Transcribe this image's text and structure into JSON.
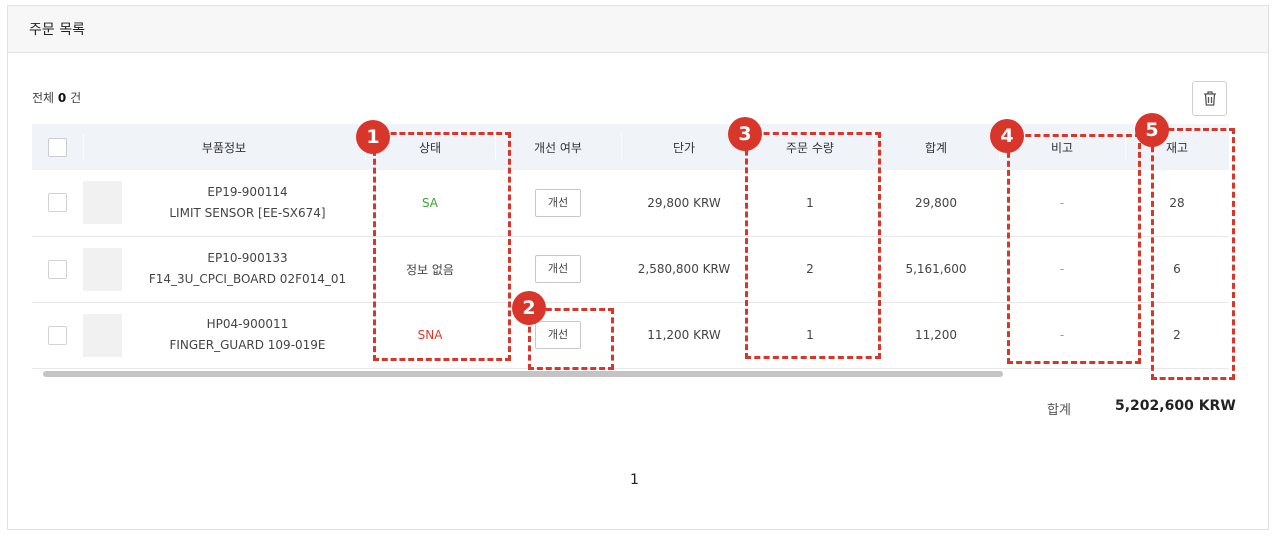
{
  "panel": {
    "title": "주문 목록"
  },
  "summary": {
    "total_prefix": "전체",
    "total_count": "0",
    "total_suffix": "건"
  },
  "table": {
    "headers": [
      "부품정보",
      "상태",
      "개선 여부",
      "단가",
      "주문 수량",
      "합계",
      "비고",
      "재고"
    ],
    "rows": [
      {
        "code": "EP19-900114",
        "name": "LIMIT SENSOR [EE-SX674]",
        "status": "SA",
        "improve": "개선",
        "unit_price": "29,800 KRW",
        "qty": "1",
        "subtotal": "29,800",
        "note": "-",
        "stock": "28"
      },
      {
        "code": "EP10-900133",
        "name": "F14_3U_CPCI_BOARD 02F014_01",
        "status": "정보 없음",
        "improve": "개선",
        "unit_price": "2,580,800 KRW",
        "qty": "2",
        "subtotal": "5,161,600",
        "note": "-",
        "stock": "6"
      },
      {
        "code": "HP04-900011",
        "name": "FINGER_GUARD 109-019E",
        "status": "SNA",
        "improve": "개선",
        "unit_price": "11,200 KRW",
        "qty": "1",
        "subtotal": "11,200",
        "note": "-",
        "stock": "2"
      }
    ]
  },
  "totals": {
    "label": "합계",
    "value": "5,202,600 KRW"
  },
  "pagination": {
    "current": "1"
  },
  "annotations": [
    "1",
    "2",
    "3",
    "4",
    "5"
  ],
  "icons": {
    "delete": "trash-icon"
  },
  "colors": {
    "status_sa": "#3aa535",
    "status_sna": "#e0392b",
    "annotation": "#d9362b",
    "header_bg": "#f0f3f8"
  }
}
